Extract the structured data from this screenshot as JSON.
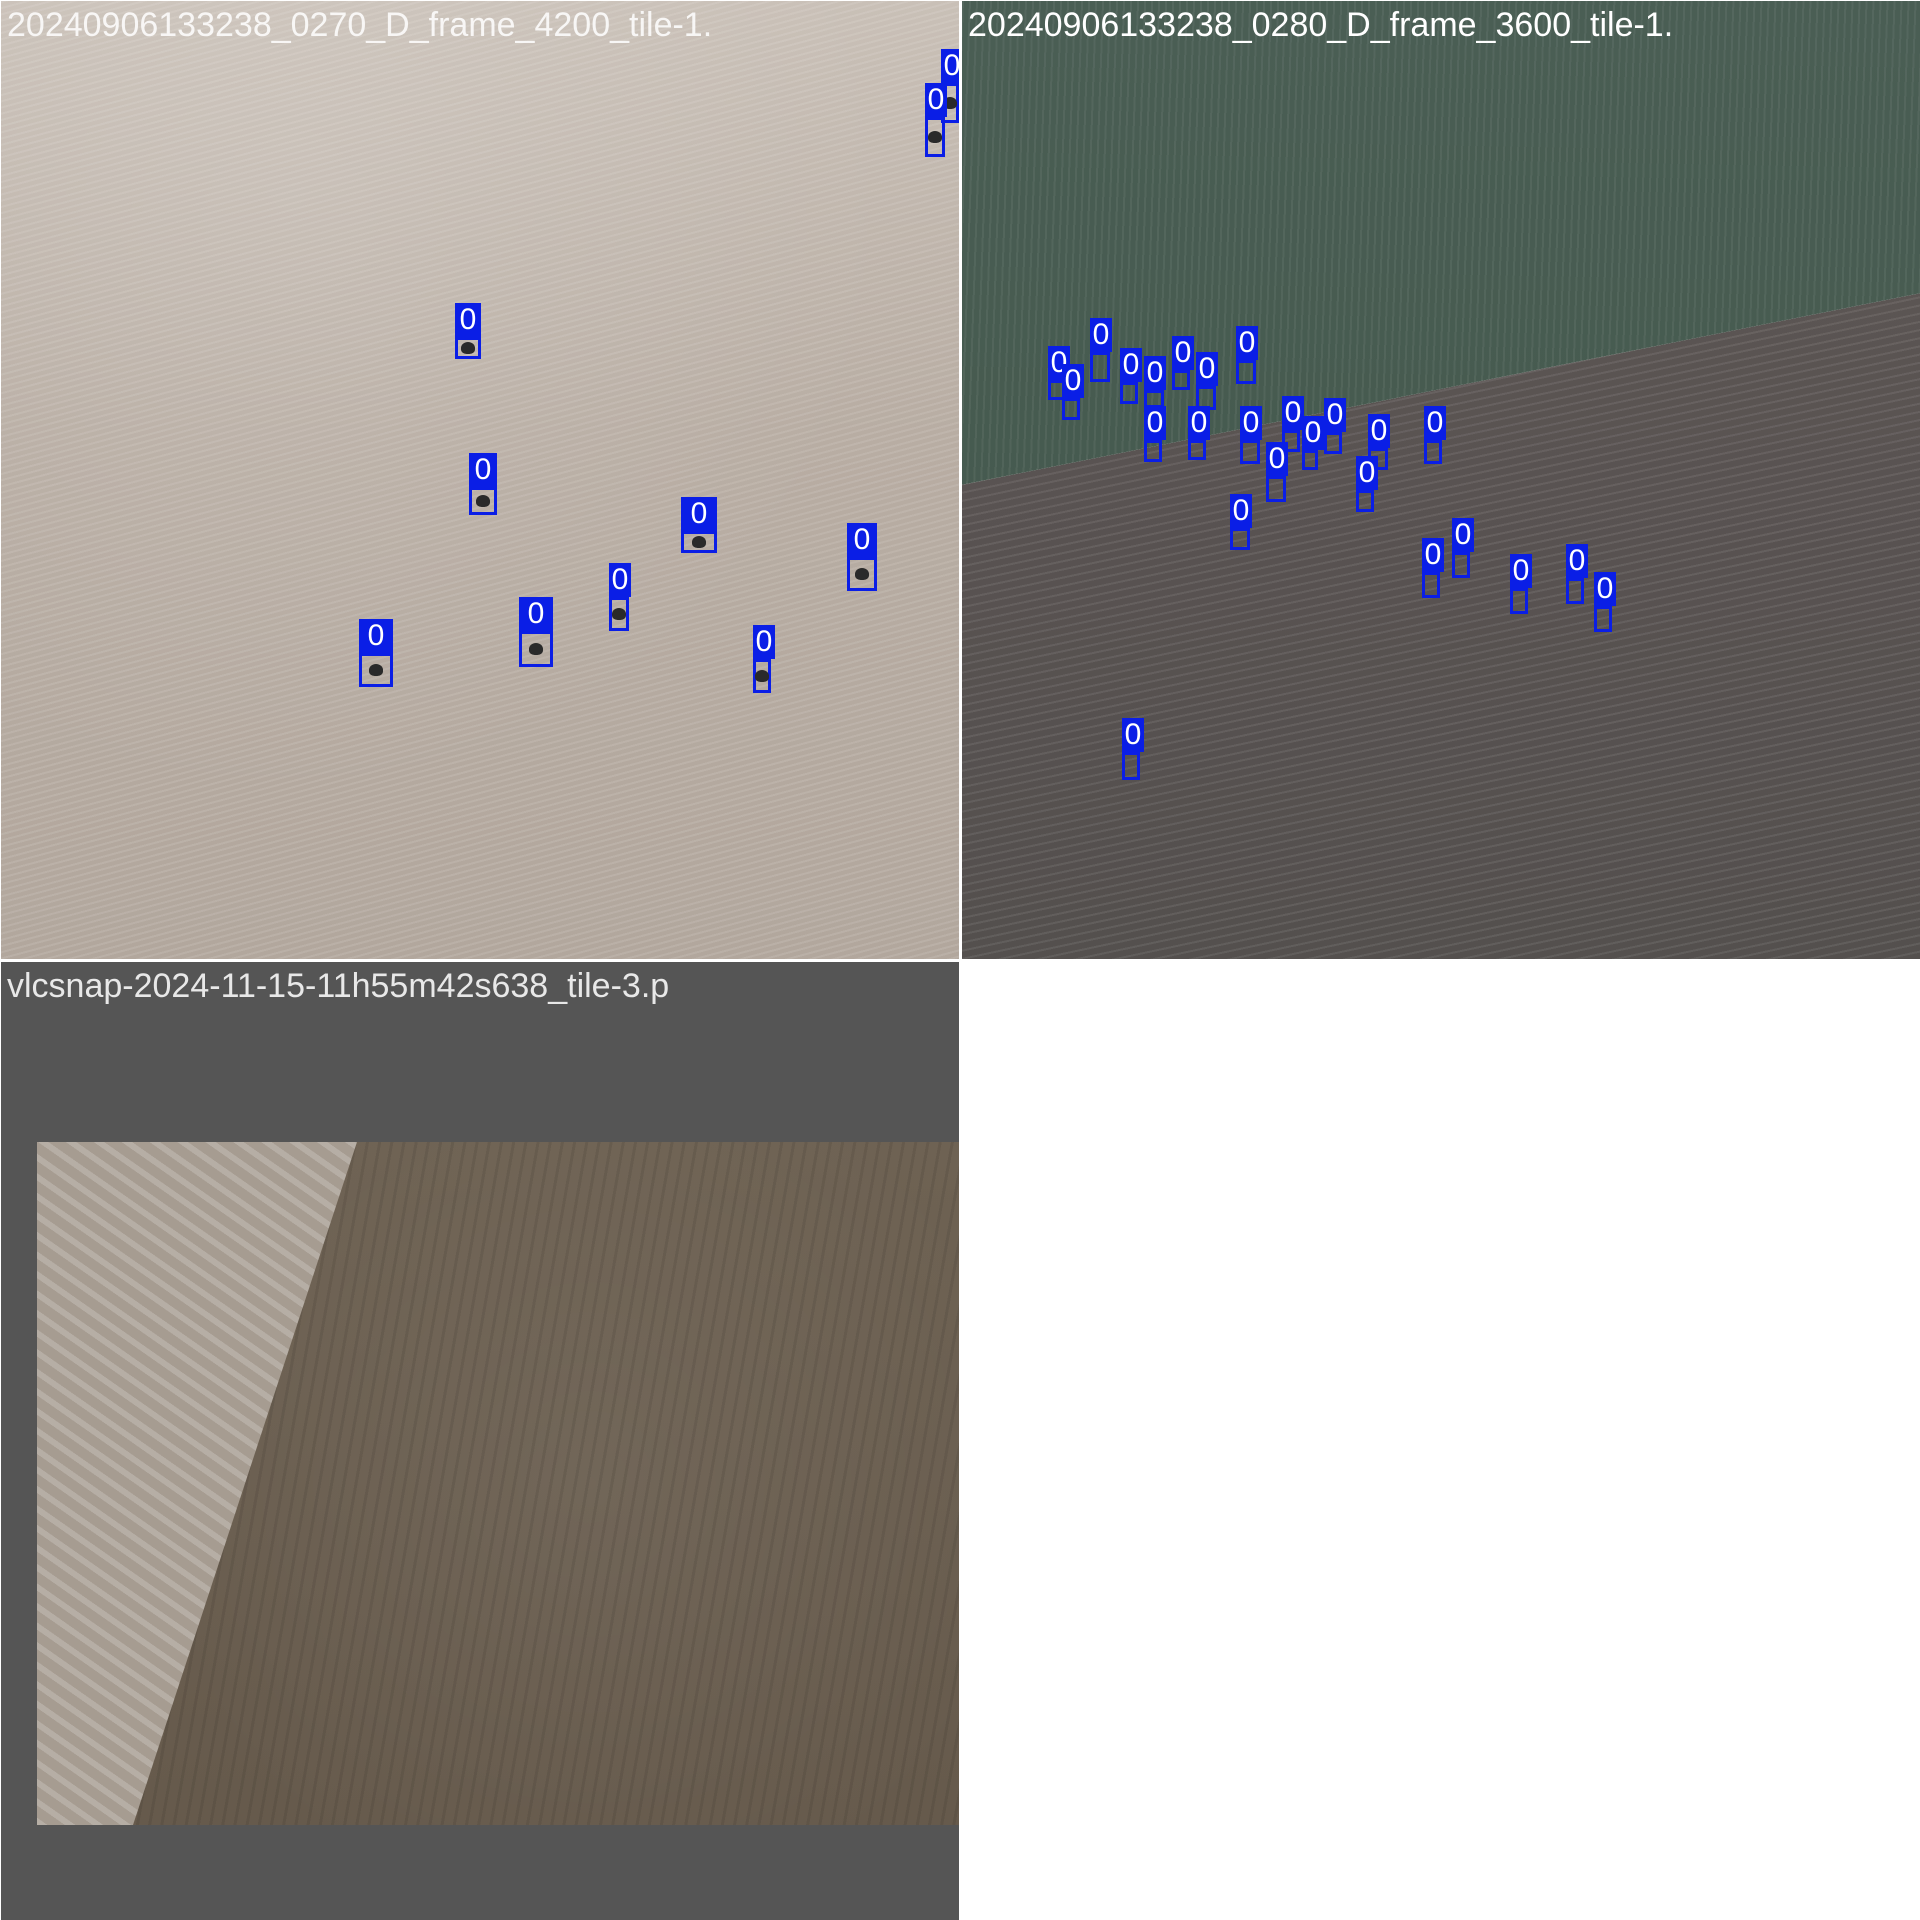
{
  "tiles": [
    {
      "title": "20240906133238_0270_D_frame_4200_tile-1.",
      "detection_label": "0",
      "detection_count": 12
    },
    {
      "title": "20240906133238_0280_D_frame_3600_tile-1.",
      "detection_label": "0",
      "detection_count": 25
    },
    {
      "title": "vlcsnap-2024-11-15-11h55m42s638_tile-3.p",
      "detection_label": "0",
      "detection_count": 0
    }
  ],
  "colors": {
    "box": "#0a1ee6",
    "label_text": "#ffffff",
    "background": "#ffffff",
    "pad": "#555555"
  }
}
